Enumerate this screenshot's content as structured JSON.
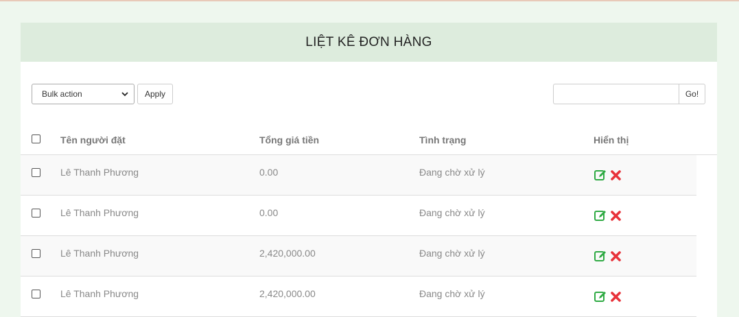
{
  "panel": {
    "title": "LIỆT KÊ ĐƠN HÀNG"
  },
  "toolbar": {
    "bulk_action_selected": "Bulk action",
    "apply_label": "Apply",
    "search_value": "",
    "go_label": "Go!"
  },
  "table": {
    "headers": {
      "name": "Tên người đặt",
      "total": "Tổng giá tiền",
      "status": "Tình trạng",
      "display": "Hiển thị"
    },
    "rows": [
      {
        "name": "Lê Thanh Phương",
        "total": "0.00",
        "status": "Đang chờ xử lý"
      },
      {
        "name": "Lê Thanh Phương",
        "total": "0.00",
        "status": "Đang chờ xử lý"
      },
      {
        "name": "Lê Thanh Phương",
        "total": "2,420,000.00",
        "status": "Đang chờ xử lý"
      },
      {
        "name": "Lê Thanh Phương",
        "total": "2,420,000.00",
        "status": "Đang chờ xử lý"
      }
    ]
  },
  "icons": {
    "edit": "edit-icon",
    "delete": "delete-icon",
    "dropdown": "chevron-down-icon"
  },
  "colors": {
    "edit_icon": "#2eaa43",
    "delete_icon": "#e8323a",
    "heading_bg": "#ddecdd",
    "page_bg": "#eef7ee"
  }
}
